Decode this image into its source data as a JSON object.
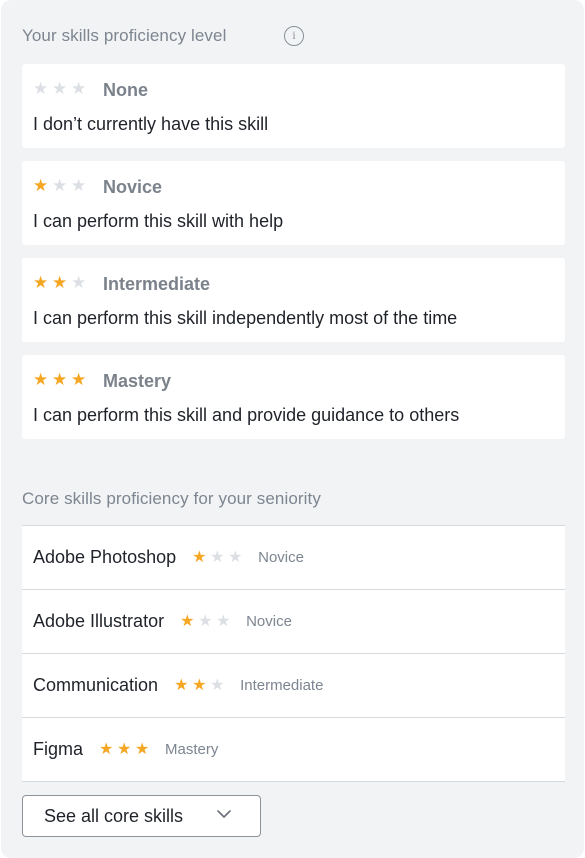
{
  "proficiency": {
    "title": "Your skills proficiency level",
    "info_icon": "info-icon",
    "levels": [
      {
        "name": "None",
        "stars": 0,
        "description": "I don’t currently have this skill"
      },
      {
        "name": "Novice",
        "stars": 1,
        "description": "I can perform this skill with help"
      },
      {
        "name": "Intermediate",
        "stars": 2,
        "description": "I can perform this skill independently most of the time"
      },
      {
        "name": "Mastery",
        "stars": 3,
        "description": "I can perform this skill and provide guidance to others"
      }
    ]
  },
  "core": {
    "title": "Core skills proficiency for your seniority",
    "skills": [
      {
        "name": "Adobe Photoshop",
        "stars": 1,
        "level": "Novice"
      },
      {
        "name": "Adobe Illustrator",
        "stars": 1,
        "level": "Novice"
      },
      {
        "name": "Communication",
        "stars": 2,
        "level": "Intermediate"
      },
      {
        "name": "Figma",
        "stars": 3,
        "level": "Mastery"
      }
    ],
    "see_all_label": "See all core skills",
    "see_all_icon": "chevron-down-icon"
  },
  "colors": {
    "star_on": "#f5a623",
    "star_off": "#dcdfe3",
    "panel_bg": "#f2f3f5"
  }
}
